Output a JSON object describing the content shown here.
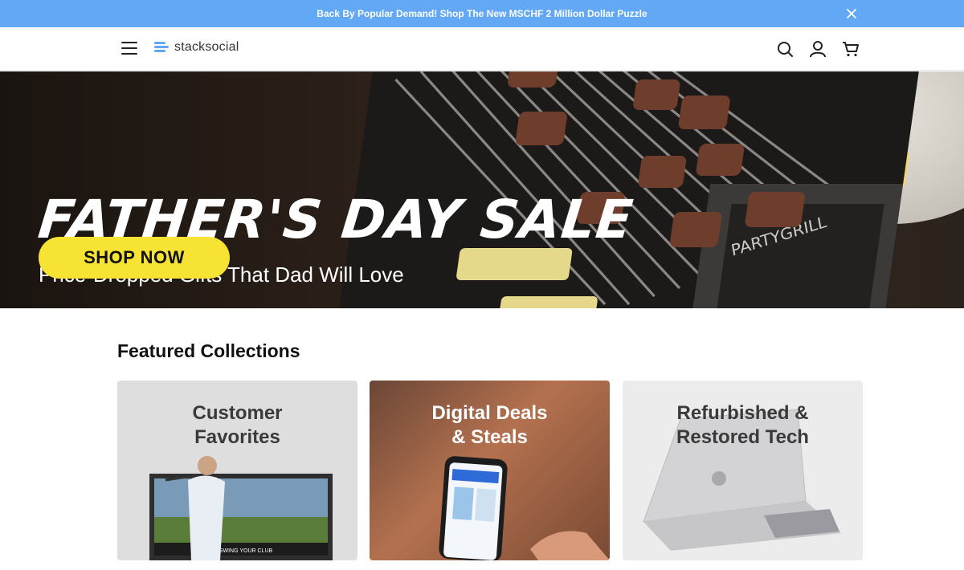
{
  "announcement": {
    "text": "Back By Popular Demand! Shop The New MSCHF 2 Million Dollar Puzzle"
  },
  "header": {
    "logo_text": "stacksocial"
  },
  "hero": {
    "title": "FATHER'S DAY SALE",
    "subtitle": "Price-Dropped Gifts That Dad Will Love",
    "button_label": "SHOP NOW",
    "grill_brand": "PARTYGRILL"
  },
  "featured": {
    "title": "Featured Collections",
    "cards": [
      {
        "label_line1": "Customer",
        "label_line2": "Favorites",
        "screen_caption": "SWING YOUR CLUB"
      },
      {
        "label_line1": "Digital Deals",
        "label_line2": "& Steals"
      },
      {
        "label_line1": "Refurbished &",
        "label_line2": "Restored Tech"
      }
    ]
  },
  "colors": {
    "announcement_bg": "#63a8f5",
    "button_yellow": "#f7e334"
  }
}
